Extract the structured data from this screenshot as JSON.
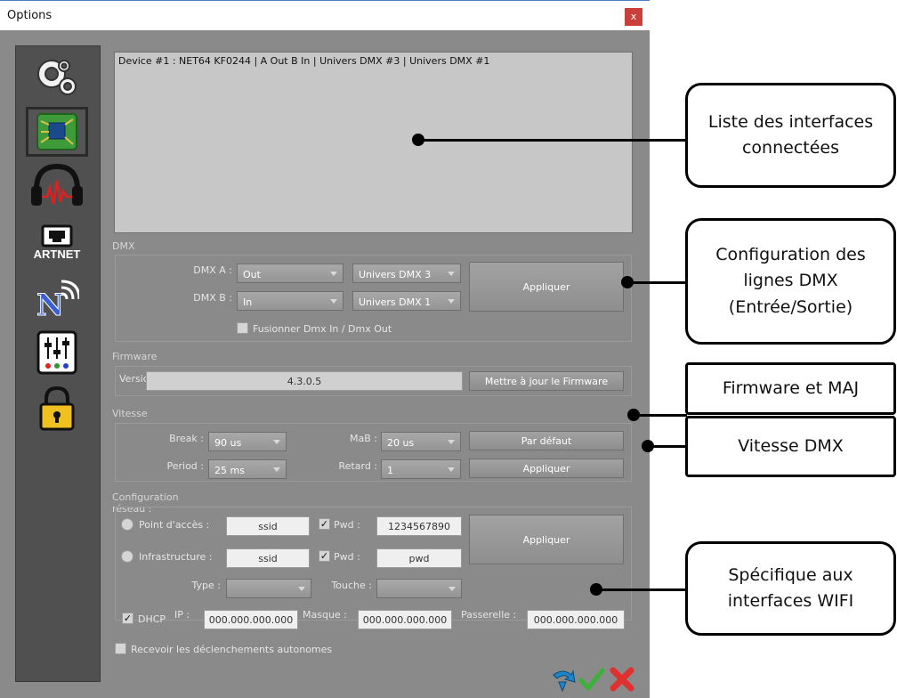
{
  "window": {
    "title": "Options",
    "close_label": "x"
  },
  "sidebar": {
    "items": [
      {
        "icon": "gears-icon"
      },
      {
        "icon": "circuit-board-icon",
        "selected": true
      },
      {
        "icon": "headphones-icon"
      },
      {
        "icon": "artnet-icon",
        "label": "ARTNET"
      },
      {
        "icon": "wireless-network-icon"
      },
      {
        "icon": "mixer-faders-icon"
      },
      {
        "icon": "padlock-icon"
      }
    ]
  },
  "devices": {
    "items": [
      "Device #1 : NET64 KF0244 | A Out B In | Univers DMX #3 | Univers DMX #1"
    ]
  },
  "dmx": {
    "section_label": "DMX",
    "a_label": "DMX A :",
    "a_mode": "Out",
    "a_universe": "Univers DMX 3",
    "b_label": "DMX B :",
    "b_mode": "In",
    "b_universe": "Univers DMX 1",
    "apply_label": "Appliquer",
    "merge_label": "Fusionner Dmx In / Dmx Out"
  },
  "firmware": {
    "section_label": "Firmware",
    "version_label": "Version :",
    "version_value": "4.3.0.5",
    "update_label": "Mettre à jour le Firmware"
  },
  "speed": {
    "section_label": "Vitesse",
    "break_label": "Break :",
    "break_value": "90 us",
    "mab_label": "MaB :",
    "mab_value": "20 us",
    "period_label": "Period :",
    "period_value": "25 ms",
    "delay_label": "Retard :",
    "delay_value": "1",
    "default_label": "Par défaut",
    "apply_label": "Appliquer"
  },
  "network": {
    "section_label": "Configuration réseau :",
    "ap_label": "Point d'accès :",
    "ap_ssid": "ssid",
    "ap_pwd_label": "Pwd :",
    "ap_pwd": "1234567890",
    "infra_label": "Infrastructure :",
    "infra_ssid": "ssid",
    "infra_pwd_label": "Pwd :",
    "infra_pwd": "pwd",
    "type_label": "Type :",
    "type_value": "",
    "touch_label": "Touche :",
    "touch_value": "",
    "dhcp_label": "DHCP",
    "ip_label": "IP :",
    "ip_value": "000.000.000.000",
    "mask_label": "Masque :",
    "mask_value": "000.000.000.000",
    "gateway_label": "Passerelle :",
    "gateway_value": "000.000.000.000",
    "apply_label": "Appliquer"
  },
  "autonomous_label": "Recevoir les déclenchements autonomes",
  "footer": {
    "icons": [
      "refresh-arrow-icon",
      "check-icon",
      "cancel-icon"
    ]
  },
  "callouts": {
    "interfaces": "Liste des interfaces connectées",
    "dmx_lines": "Configuration des lignes DMX (Entrée/Sortie)",
    "firmware": "Firmware et MAJ",
    "speed": "Vitesse DMX",
    "wifi": "Spécifique aux interfaces WIFI"
  }
}
